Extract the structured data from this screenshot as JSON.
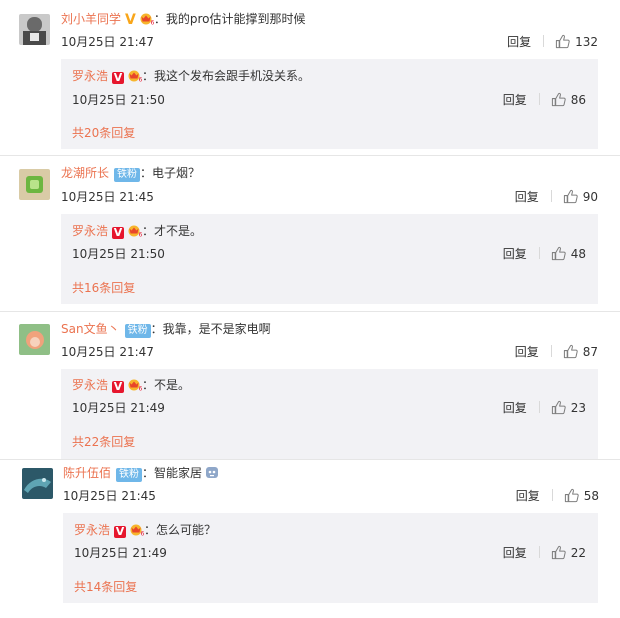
{
  "reply_label": "回复",
  "comments": [
    {
      "user": "刘小羊同学",
      "verified": "gold",
      "text": "：我的pro估计能撑到那时候",
      "time": "10月25日 21:47",
      "likes": "132",
      "reply": {
        "user": "罗永浩",
        "text": "：我这个发布会跟手机没关系。",
        "time": "10月25日 21:50",
        "likes": "86"
      },
      "total": "共20条回复"
    },
    {
      "user": "龙潮所长",
      "fan_badge": "铁粉",
      "text": "：电子烟？",
      "time": "10月25日 21:45",
      "likes": "90",
      "reply": {
        "user": "罗永浩",
        "text": "：才不是。",
        "time": "10月25日 21:50",
        "likes": "48"
      },
      "total": "共16条回复"
    },
    {
      "user": "San文鱼丶",
      "fan_badge": "铁粉",
      "text": "：我靠，是不是家电啊",
      "time": "10月25日 21:47",
      "likes": "87",
      "reply": {
        "user": "罗永浩",
        "text": "：不是。",
        "time": "10月25日 21:49",
        "likes": "23"
      },
      "total": "共22条回复"
    },
    {
      "user": "陈升伍佰",
      "fan_badge": "铁粉",
      "text": "：智能家居",
      "time": "10月25日 21:45",
      "likes": "58",
      "reply": {
        "user": "罗永浩",
        "text": "：怎么可能？",
        "time": "10月25日 21:49",
        "likes": "22"
      },
      "total": "共14条回复"
    }
  ]
}
